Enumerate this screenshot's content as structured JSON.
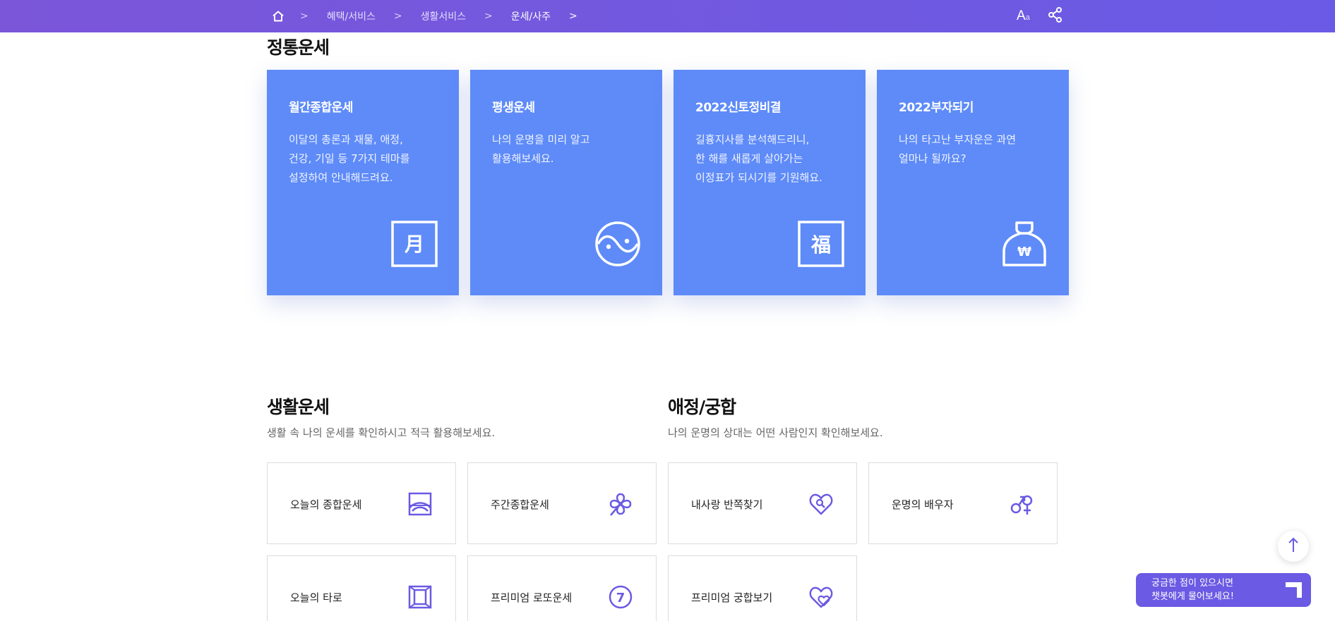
{
  "breadcrumb": {
    "items": [
      "혜택/서비스",
      "생활서비스",
      "운세/사주"
    ]
  },
  "header_tools": {
    "font_size_label": "A",
    "font_size_sub": "a"
  },
  "main_section": {
    "title": "정통운세",
    "cards": [
      {
        "title": "월간종합운세",
        "desc": "이달의 총론과 재물, 애정,\n건강, 기일 등 7가지 테마를\n설정하여 안내해드려요.",
        "icon": "moon-calendar-icon",
        "glyph": "月"
      },
      {
        "title": "평생운세",
        "desc": "나의 운명을 미리 알고\n활용해보세요.",
        "icon": "yin-yang-icon"
      },
      {
        "title": "2022신토정비결",
        "desc": "길흉지사를 분석해드리니,\n한 해를 새롭게 살아가는\n이정표가 되시기를 기원해요.",
        "icon": "fortune-bok-icon",
        "glyph": "福"
      },
      {
        "title": "2022부자되기",
        "desc": "나의 타고난 부자운은 과연\n얼마나 될까요?",
        "icon": "money-bag-icon",
        "glyph": "₩"
      }
    ]
  },
  "life_section": {
    "title": "생활운세",
    "desc": "생활 속 나의 운세를 확인하시고 적극 활용해보세요.",
    "items": [
      {
        "label": "오늘의 종합운세",
        "icon": "sunrise-frame-icon"
      },
      {
        "label": "주간종합운세",
        "icon": "clover-icon"
      },
      {
        "label": "오늘의 타로",
        "icon": "tarot-cards-icon"
      },
      {
        "label": "프리미엄 로또운세",
        "icon": "lotto-seven-icon",
        "glyph": "7"
      }
    ]
  },
  "love_section": {
    "title": "애정/궁합",
    "desc": "나의 운명의 상대는 어떤 사람인지 확인해보세요.",
    "items": [
      {
        "label": "내사랑 반쪽찾기",
        "icon": "heart-search-icon"
      },
      {
        "label": "운명의 배우자",
        "icon": "gender-symbols-icon"
      },
      {
        "label": "프리미엄 궁합보기",
        "icon": "double-heart-icon"
      }
    ]
  },
  "chatbot": {
    "text": "궁금한 점이 있으시면\n챗봇에게 물어보세요!"
  },
  "colors": {
    "header": "#7059e0",
    "card": "#5e8bf8",
    "icon_purple": "#6b5ae3"
  }
}
